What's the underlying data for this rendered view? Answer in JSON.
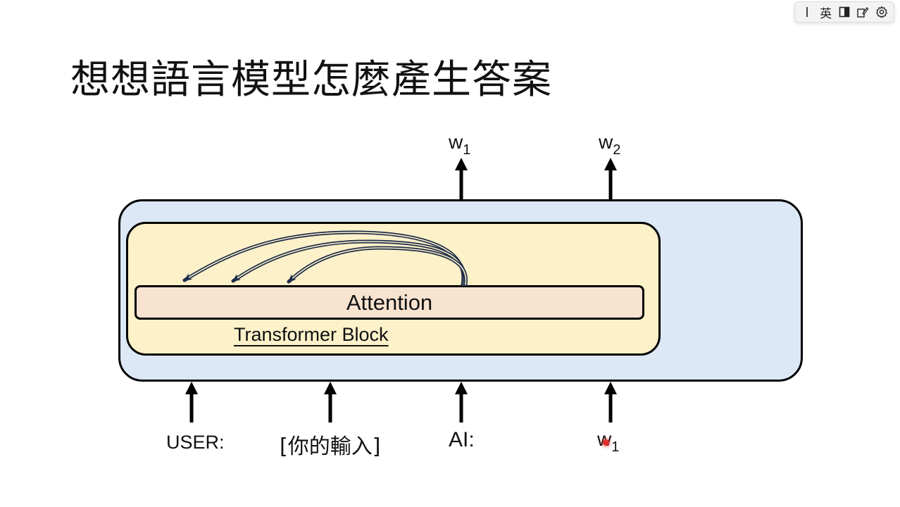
{
  "ime_toolbar": {
    "lang_label": "英"
  },
  "slide": {
    "title": "想想語言模型怎麼產生答案"
  },
  "diagram": {
    "attention_label": "Attention",
    "block_label": "Transformer Block",
    "outputs": [
      {
        "base": "w",
        "sub": "1"
      },
      {
        "base": "w",
        "sub": "2"
      }
    ],
    "inputs": [
      {
        "text": "USER:"
      },
      {
        "text": "[你的輸入]"
      },
      {
        "text": "AI:"
      },
      {
        "base": "w",
        "sub": "1"
      }
    ]
  },
  "colors": {
    "outer_box": "#dde8f6",
    "inner_box": "#fcf1c9",
    "attention_box": "#f8e3d1",
    "attention_arrows": "#1f2d4a"
  }
}
